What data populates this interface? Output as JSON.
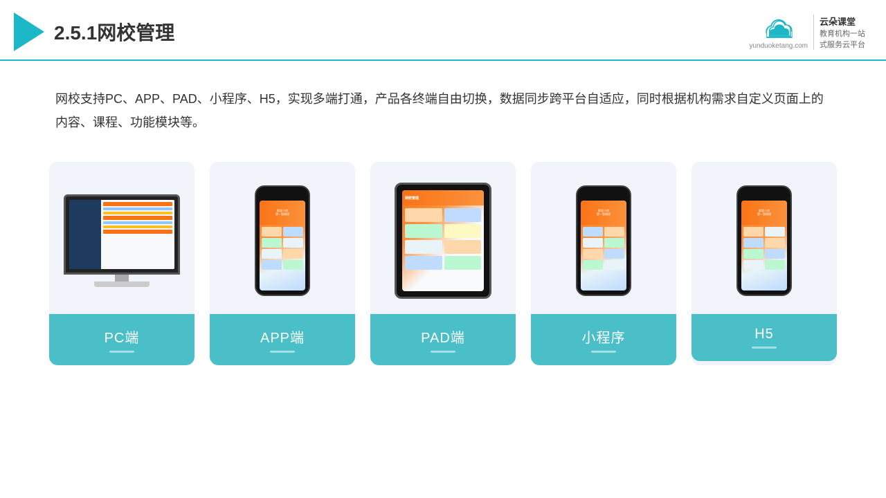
{
  "header": {
    "title": "2.5.1网校管理",
    "brand_name": "云朵课堂",
    "brand_tagline": "教育机构一站\n式服务云平台",
    "brand_url": "yunduoketang.com"
  },
  "description": {
    "text": "网校支持PC、APP、PAD、小程序、H5，实现多端打通，产品各终端自由切换，数据同步跨平台自适应，同时根据机构需求自定义页面上的内容、课程、功能模块等。"
  },
  "cards": [
    {
      "id": "pc",
      "label": "PC端"
    },
    {
      "id": "app",
      "label": "APP端"
    },
    {
      "id": "pad",
      "label": "PAD端"
    },
    {
      "id": "miniprogram",
      "label": "小程序"
    },
    {
      "id": "h5",
      "label": "H5"
    }
  ],
  "accent_color": "#4bbfc8"
}
